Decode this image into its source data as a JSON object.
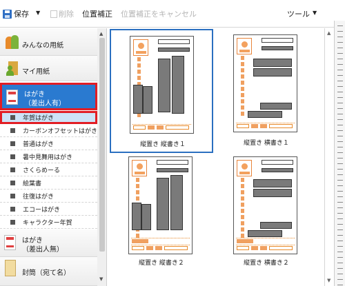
{
  "toolbar": {
    "save_label": "保存",
    "delete_label": "削除",
    "position_adjust_label": "位置補正",
    "cancel_position_adjust_label": "位置補正をキャンセル",
    "tools_label": "ツール"
  },
  "sidebar": {
    "categories": [
      {
        "label": "みんなの用紙"
      },
      {
        "label": "マイ用紙"
      },
      {
        "label_line1": "はがき",
        "label_line2": "（差出人有）"
      },
      {
        "label_line1": "はがき",
        "label_line2": "（差出人無）"
      },
      {
        "label": "封筒（宛て名）"
      }
    ],
    "subitems": [
      {
        "label": "年賀はがき"
      },
      {
        "label": "カーボンオフセットはがき"
      },
      {
        "label": "普通はがき"
      },
      {
        "label": "暑中見舞用はがき"
      },
      {
        "label": "さくらめーる"
      },
      {
        "label": "絵葉書"
      },
      {
        "label": "往復はがき"
      },
      {
        "label": "エコーはがき"
      },
      {
        "label": "キャラクター年賀"
      }
    ]
  },
  "layouts": [
    {
      "label": "縦置き 縦書き１"
    },
    {
      "label": "縦置き 横書き１"
    },
    {
      "label": "縦置き 縦書き２"
    },
    {
      "label": "縦置き 横書き２"
    }
  ],
  "colors": {
    "selected_blue": "#2a7ad0",
    "highlight_red": "#e21d24",
    "stamp_orange": "#e8843a"
  }
}
